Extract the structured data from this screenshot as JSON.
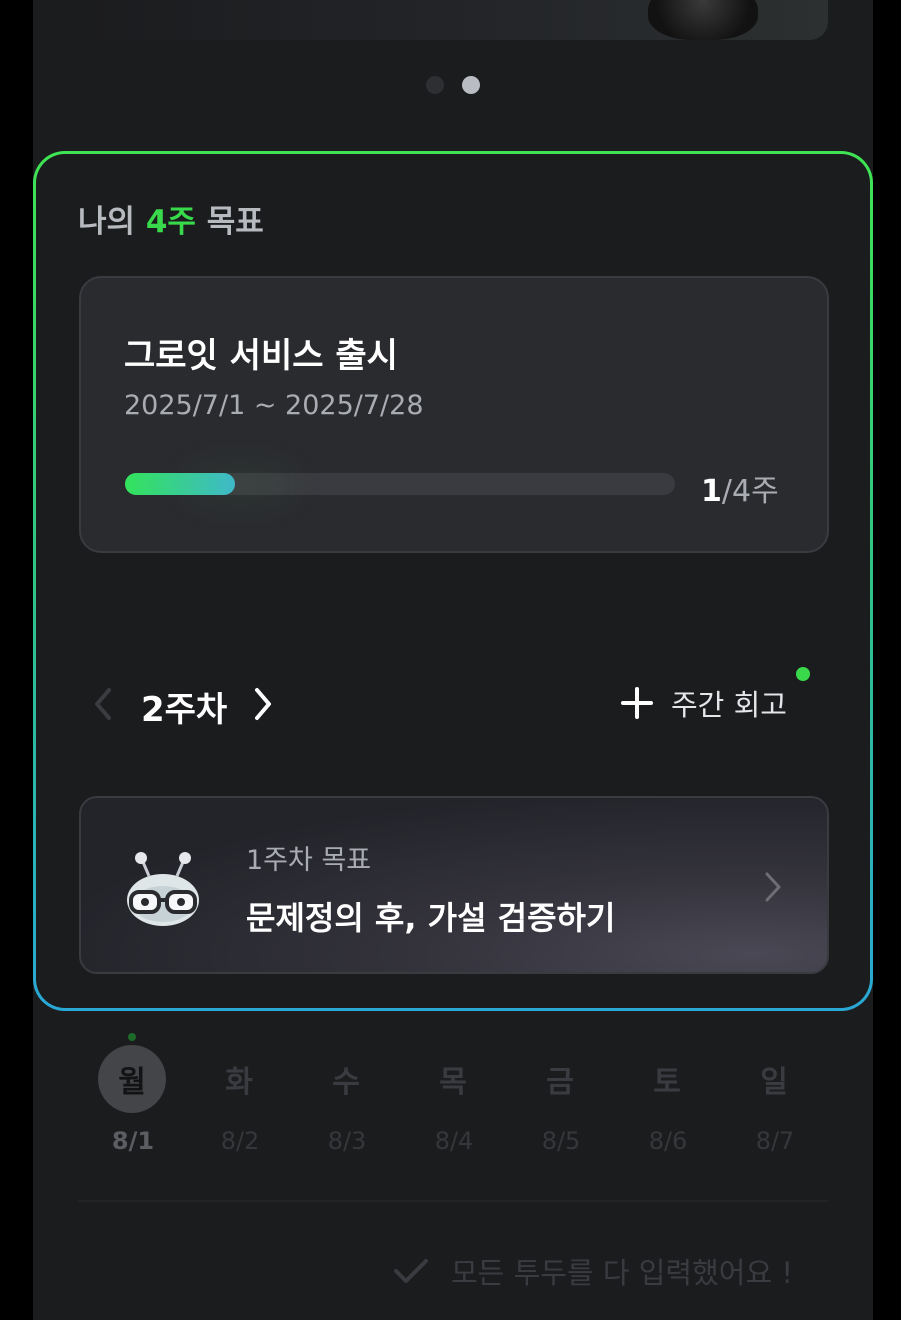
{
  "goal_section": {
    "heading_prefix": "나의",
    "heading_accent": "4주",
    "heading_suffix": "목표",
    "accent_color": "#38d94a"
  },
  "plan": {
    "title": "그로잇 서비스 출시",
    "dates": "2025/7/1 ~ 2025/7/28",
    "progress_current": "1",
    "progress_total": "/4주",
    "progress_fraction": 0.2
  },
  "week_nav": {
    "prev_icon": "chevron-left-icon",
    "label": "2주차",
    "next_icon": "chevron-right-icon",
    "retro_label": "주간 회고"
  },
  "week_goal": {
    "sub_label": "1주차 목표",
    "title": "문제정의 후, 가설 검증하기"
  },
  "calendar": {
    "days": [
      {
        "day": "월",
        "date": "8/1",
        "active": true
      },
      {
        "day": "화",
        "date": "8/2",
        "active": false
      },
      {
        "day": "수",
        "date": "8/3",
        "active": false
      },
      {
        "day": "목",
        "date": "8/4",
        "active": false
      },
      {
        "day": "금",
        "date": "8/5",
        "active": false
      },
      {
        "day": "토",
        "date": "8/6",
        "active": false
      },
      {
        "day": "일",
        "date": "8/7",
        "active": false
      }
    ]
  },
  "status": {
    "all_done": "모든 투두를 다 입력했어요 !"
  }
}
